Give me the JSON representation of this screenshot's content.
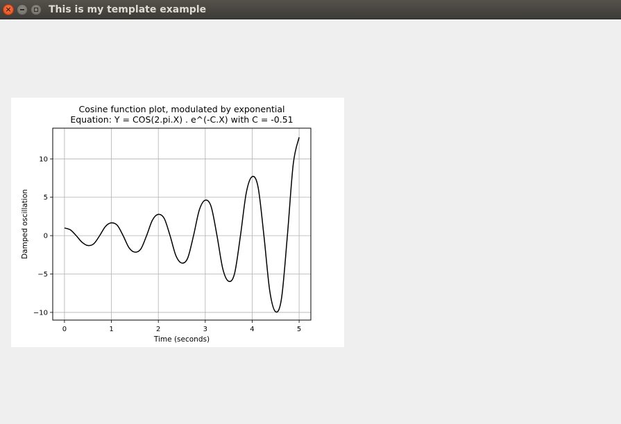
{
  "window": {
    "title": "This is my template example",
    "controls": {
      "close": "×",
      "minimize": "–",
      "maximize": "□"
    }
  },
  "chart_data": {
    "type": "line",
    "title": "Cosine function plot, modulated by exponential",
    "subtitle": "Equation: Y = COS(2.pi.X) . e^(-C.X) with C = -0.51",
    "xlabel": "Time (seconds)",
    "ylabel": "Damped oscillation",
    "xlim": [
      -0.25,
      5.25
    ],
    "ylim": [
      -11,
      14
    ],
    "xticks": [
      0,
      1,
      2,
      3,
      4,
      5
    ],
    "xtick_labels": [
      "0",
      "1",
      "2",
      "3",
      "4",
      "5"
    ],
    "yticks": [
      -10,
      -5,
      0,
      5,
      10
    ],
    "ytick_labels": [
      "−10",
      "−5",
      "0",
      "5",
      "10"
    ],
    "grid": true,
    "line_color": "#000000",
    "series": [
      {
        "x": [
          0,
          0.125,
          0.25,
          0.375,
          0.5,
          0.625,
          0.75,
          0.875,
          1,
          1.125,
          1.25,
          1.375,
          1.5,
          1.625,
          1.75,
          1.875,
          2,
          2.125,
          2.25,
          2.375,
          2.5,
          2.625,
          2.75,
          2.875,
          3,
          3.125,
          3.25,
          3.375,
          3.5,
          3.625,
          3.75,
          3.875,
          4,
          4.125,
          4.25,
          4.375,
          4.5,
          4.625,
          4.75,
          4.875,
          5
        ],
        "y": [
          1,
          0.75,
          0,
          -0.86,
          -1.29,
          -1.06,
          0,
          1.21,
          1.67,
          1.35,
          0,
          -1.57,
          -2.15,
          -1.76,
          0,
          2.03,
          2.77,
          2.25,
          0,
          -2.61,
          -3.57,
          -2.94,
          0,
          3.37,
          4.62,
          3.79,
          0,
          -4.35,
          -5.95,
          -4.92,
          0,
          5.61,
          7.69,
          6.34,
          0,
          -7.22,
          -9.92,
          -8.17,
          0,
          9.33,
          12.81
        ]
      }
    ]
  }
}
